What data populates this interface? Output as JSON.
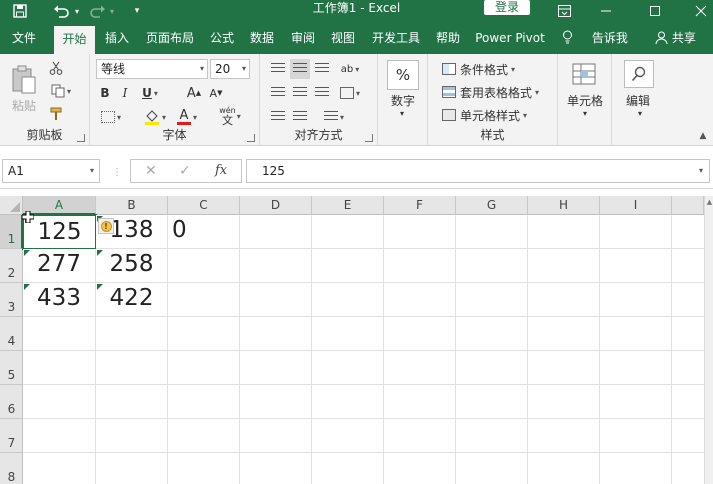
{
  "titlebar": {
    "title": "工作簿1  -  Excel",
    "login": "登录",
    "icons": [
      "save-icon",
      "undo-icon",
      "redo-icon",
      "qat-customize-icon",
      "ribbon-display-icon",
      "minimize-icon",
      "maximize-icon",
      "close-icon"
    ]
  },
  "tabs": [
    {
      "label": "文件"
    },
    {
      "label": "开始"
    },
    {
      "label": "插入"
    },
    {
      "label": "页面布局"
    },
    {
      "label": "公式"
    },
    {
      "label": "数据"
    },
    {
      "label": "审阅"
    },
    {
      "label": "视图"
    },
    {
      "label": "开发工具"
    },
    {
      "label": "帮助"
    },
    {
      "label": "Power Pivot"
    }
  ],
  "tell_me": "告诉我",
  "share": "共享",
  "ribbon": {
    "clipboard": {
      "label": "剪贴板",
      "paste": "粘贴"
    },
    "font": {
      "label": "字体",
      "name": "等线",
      "size": "20",
      "bold": "B",
      "italic": "I",
      "underline": "U",
      "grow": "A",
      "shrink": "A",
      "font_color": "A",
      "pinyin": "wén"
    },
    "alignment": {
      "label": "对齐方式"
    },
    "number": {
      "label": "数字",
      "button": "数字",
      "symbol": "%"
    },
    "styles": {
      "label": "样式",
      "conditional": "条件格式",
      "table": "套用表格格式",
      "cell": "单元格样式"
    },
    "cells": {
      "label": "单元格"
    },
    "editing": {
      "label": "编辑"
    }
  },
  "formula_bar": {
    "name_box": "A1",
    "cancel": "✕",
    "enter": "✓",
    "fx": "fx",
    "value": "125"
  },
  "grid": {
    "columns": [
      "A",
      "B",
      "C",
      "D",
      "E",
      "F",
      "G",
      "H",
      "I"
    ],
    "rows": [
      "1",
      "2",
      "3",
      "4",
      "5",
      "6",
      "7",
      "8"
    ],
    "cells": {
      "A1": "125",
      "B1": "138",
      "C1": "0",
      "A2": "277",
      "B2": "258",
      "A3": "433",
      "B3": "422"
    },
    "warning_symbol": "!"
  }
}
